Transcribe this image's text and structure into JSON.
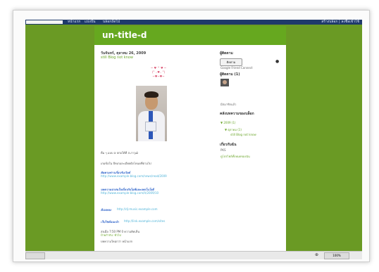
{
  "blogger_bar": {
    "links": [
      "หน้าแรก",
      "แบ่งปัน",
      "บล็อกถัดไป"
    ],
    "right_text": "สร้างบล็อก | ลงชื่อเข้าใช้"
  },
  "header": {
    "blog_title": "un-title-d"
  },
  "post": {
    "date": "วันจันทร์, ตุลาคม 26, 2009",
    "title": "still Blog not know",
    "decor_lines": [
      "~ ♥ ^ ♥ ~",
      "(\" ..♥.. \")",
      "~♥~♥~"
    ],
    "body_lines": [
      "ดื่ม ๆ แบบ a ปก่อให้ที่ ส.ภาวุฒิ",
      "เกมข้อใน บีทเกมละเอียดฝั่งโหนดที่ตามไป"
    ],
    "links": [
      {
        "label": "ติดตามข่าวเกี่ยวกับเวิลด์",
        "desc": "http://www.example-blog.com/news/read/2009"
      },
      {
        "label": "บทความน่าสนใจเกี่ยวกับไอทีและเทคโนโลยี",
        "desc": "http://www.example-blog.com/it/2009/10"
      },
      {
        "label": "ดีเจเพลง",
        "desc": "http://dj-music.example.com"
      },
      {
        "label": "เว็บไซต์แนะนำ",
        "desc": "http://link.example.com/sites"
      }
    ],
    "footer_line1": "ส่งเมื่อ 7:50 PM 0 ความคิดเห็น",
    "footer_line2": "ป้ายกำกับ: ทั่วไป",
    "footer_line3": "บทความใหม่กว่า  หน้าแรก"
  },
  "sidebar": {
    "follow_title": "ผู้ติดตาม",
    "follow_button": "ติดตาม",
    "follow_caption": "Google Friend Connect",
    "followers_title": "ผู้ติดตาม (1)",
    "about_line": "มีสมาชิกแล้ว",
    "archive_title": "คลังบทความของบล็อก",
    "archive_year": "▼ 2009 (1)",
    "archive_month": "▼ ตุลาคม (1)",
    "archive_post": "still Blog not know",
    "about_title": "เกี่ยวกับฉัน",
    "about_name": "PKS",
    "profile_link": "ดูโปรไฟล์ทั้งหมดของฉัน"
  },
  "statusbar": {
    "zoom": "100%"
  }
}
